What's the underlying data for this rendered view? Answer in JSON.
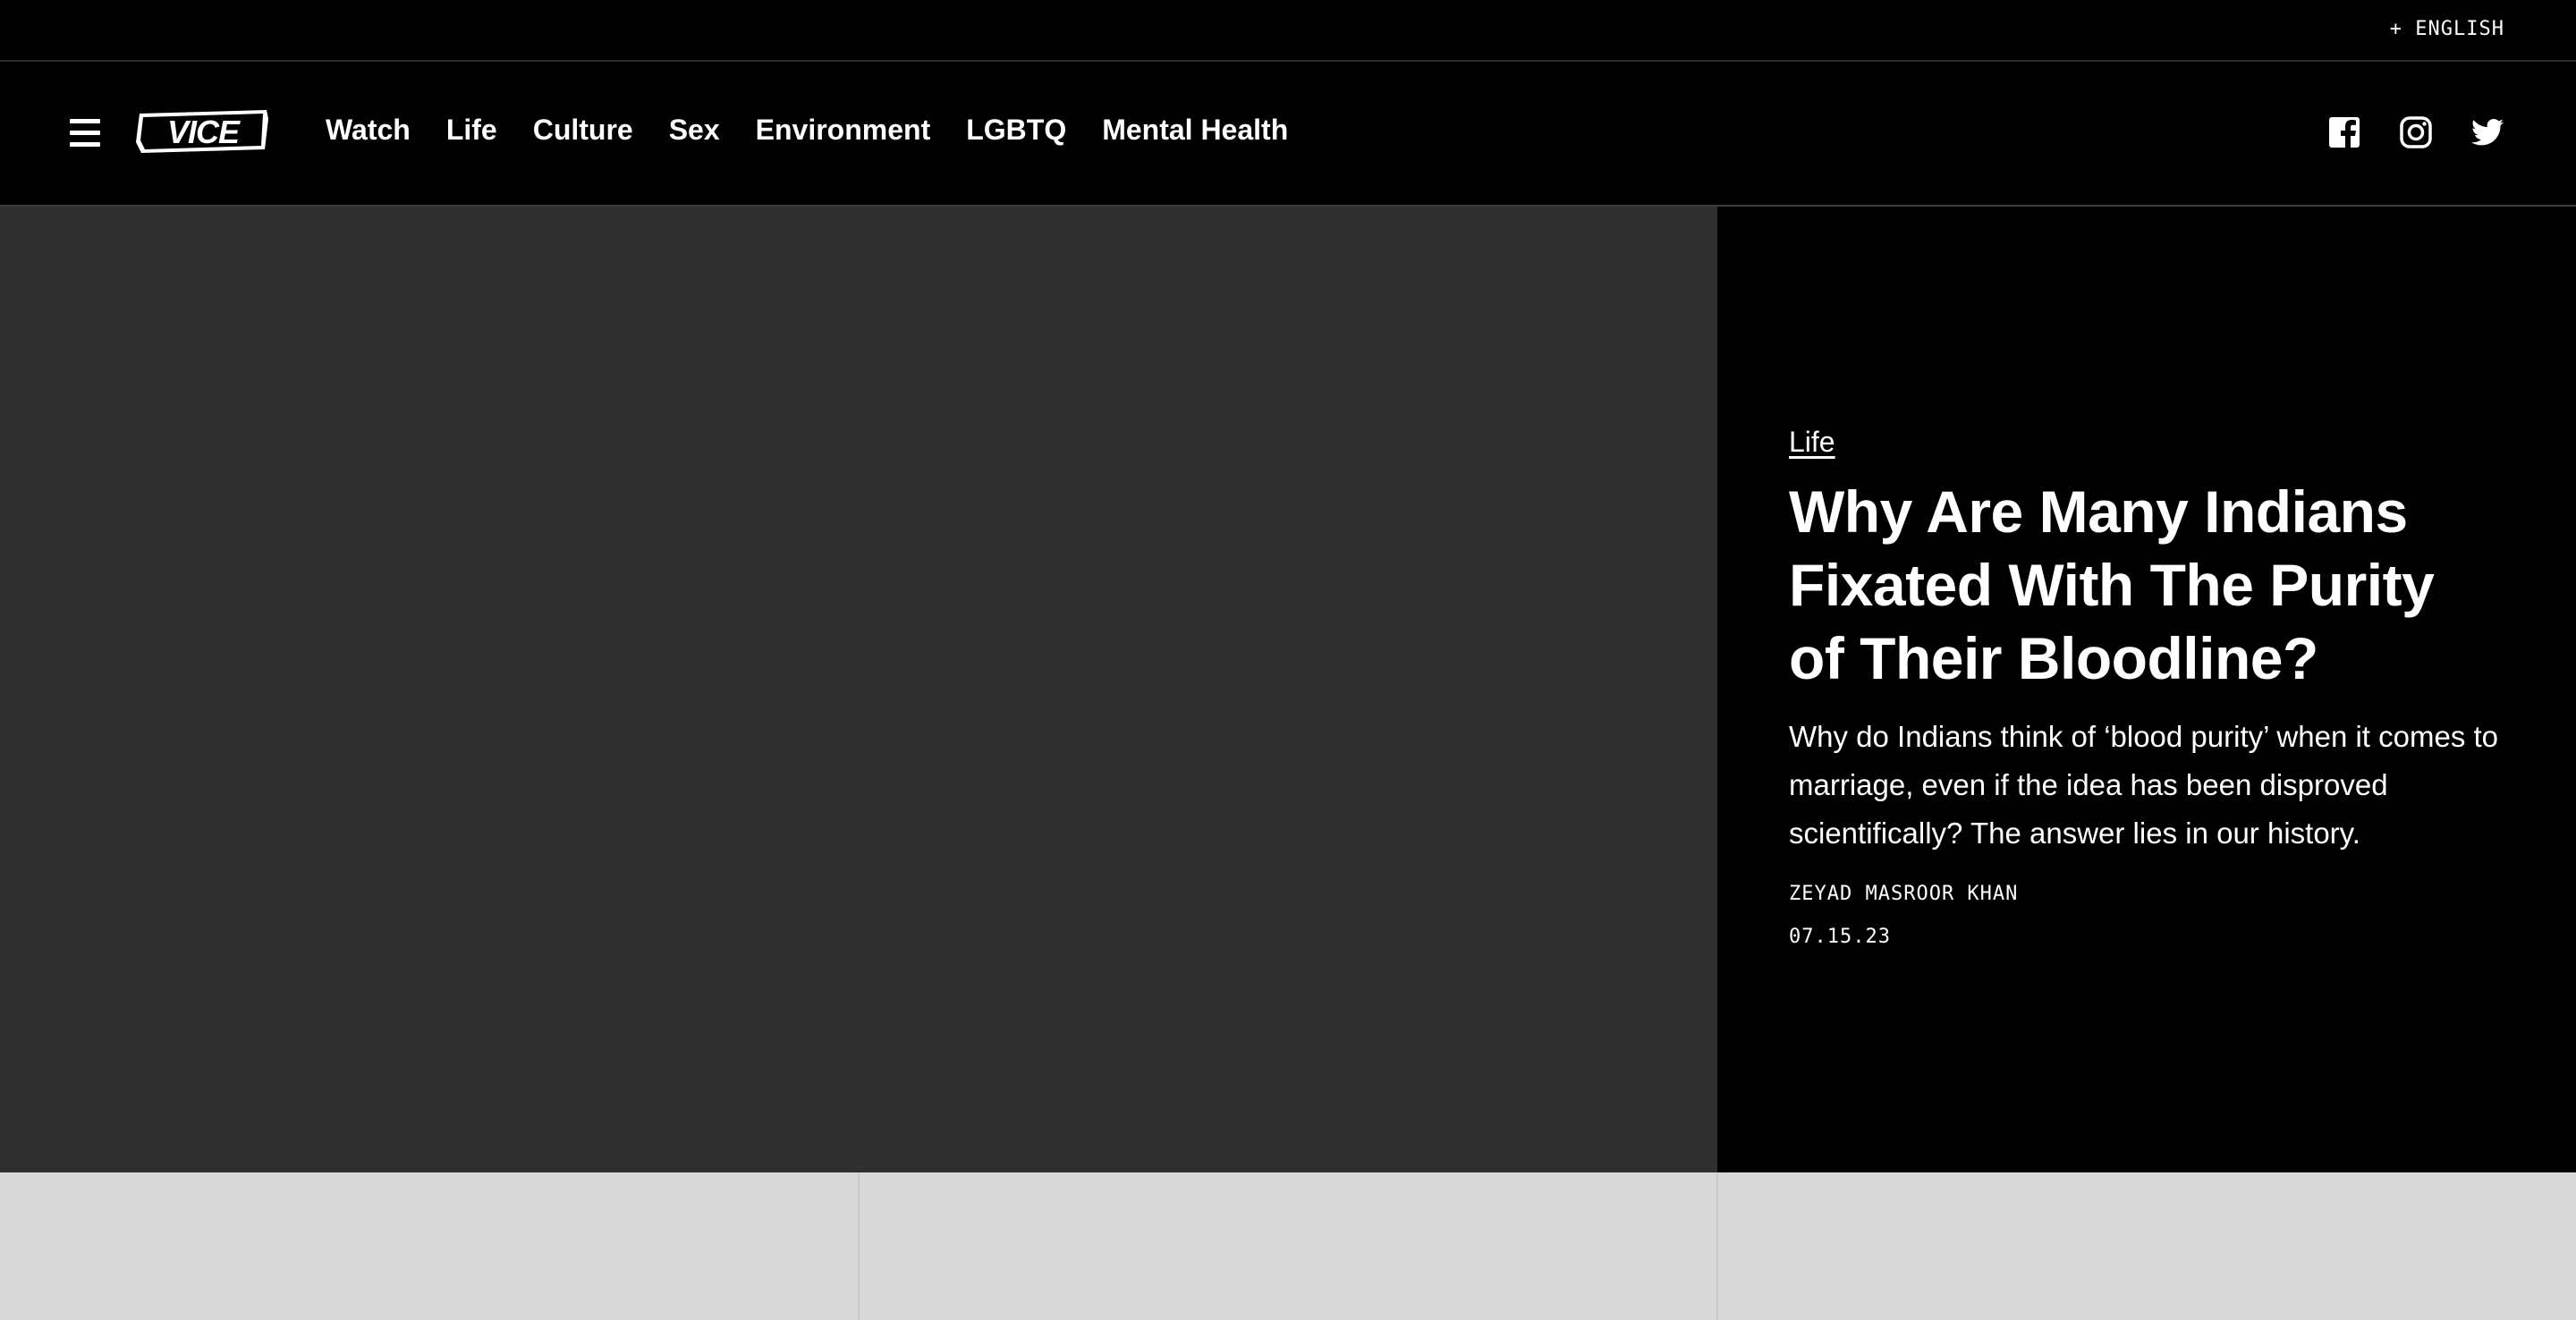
{
  "topbar": {
    "language_label": "+ ENGLISH"
  },
  "nav": {
    "menu_icon": "hamburger-menu-icon",
    "logo_icon": "vice-logo",
    "items": [
      "Watch",
      "Life",
      "Culture",
      "Sex",
      "Environment",
      "LGBTQ",
      "Mental Health"
    ],
    "social_icons": [
      "facebook-icon",
      "instagram-icon",
      "twitter-icon"
    ]
  },
  "hero": {
    "category": "Life",
    "headline": "Why Are Many Indians Fixated With The Purity of Their Bloodline?",
    "dek": "Why do Indians think of ‘blood purity’ when it comes to marriage, even if the idea has been disproved scientifically? The answer lies in our history.",
    "author": "ZEYAD MASROOR KHAN",
    "date": "07.15.23"
  },
  "colors": {
    "background": "#000000",
    "image_placeholder": "#2f2f2f",
    "card_placeholder": "#d9d9d9",
    "text": "#ffffff"
  }
}
